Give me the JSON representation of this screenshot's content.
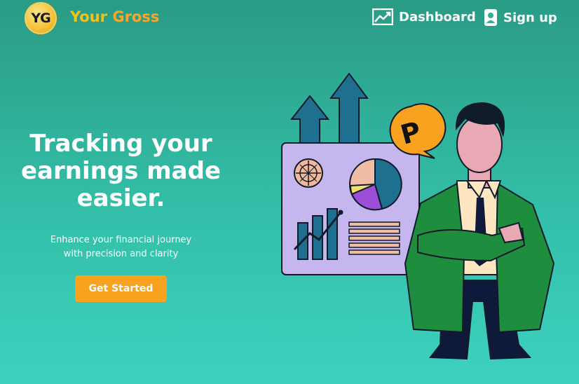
{
  "brand": {
    "logo_text": "YG",
    "name_part1": "Your",
    "name_part2": "Gross"
  },
  "nav": {
    "dashboard": "Dashboard",
    "signup": "Sign up"
  },
  "hero": {
    "headline_lines": [
      "Tracking your",
      "earnings made",
      "easier."
    ],
    "subtext_lines": [
      "Enhance your financial journey",
      "with precision and clarity"
    ],
    "cta": "Get Started"
  },
  "illustration": {
    "coin_symbol": "P"
  },
  "colors": {
    "accent_orange": "#f8a220",
    "brand_yellow": "#f0c21a",
    "bg_teal": "#33bfa9"
  },
  "icons": [
    "chart-line-icon",
    "user-badge-icon"
  ]
}
